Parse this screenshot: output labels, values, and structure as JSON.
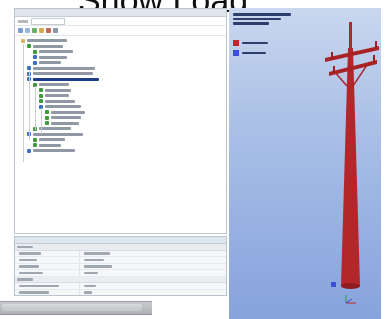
{
  "page": {
    "headline": "Show Load"
  },
  "outline": {
    "title": "",
    "filter_label": "",
    "filter_value": "",
    "tree": [
      {
        "label": ""
      },
      {
        "label": ""
      },
      {
        "label": ""
      },
      {
        "label": ""
      },
      {
        "label": ""
      },
      {
        "label": ""
      },
      {
        "label": ""
      },
      {
        "label": ""
      },
      {
        "label": ""
      },
      {
        "label": ""
      },
      {
        "label": ""
      },
      {
        "label": ""
      },
      {
        "label": ""
      },
      {
        "label": ""
      },
      {
        "label": ""
      },
      {
        "label": ""
      },
      {
        "label": ""
      },
      {
        "label": ""
      },
      {
        "label": ""
      },
      {
        "label": ""
      },
      {
        "label": ""
      },
      {
        "label": ""
      },
      {
        "label": ""
      }
    ]
  },
  "details": {
    "groups": [
      {
        "title": "",
        "rows": [
          {
            "key": "",
            "value": ""
          },
          {
            "key": "",
            "value": ""
          },
          {
            "key": "",
            "value": ""
          },
          {
            "key": "",
            "value": ""
          }
        ]
      },
      {
        "title": "",
        "rows": [
          {
            "key": "",
            "value": ""
          },
          {
            "key": "",
            "value": ""
          }
        ]
      }
    ]
  },
  "viewport": {
    "title_lines": [
      "",
      "",
      ""
    ],
    "legend": [
      {
        "label": "",
        "color": "#c0272d"
      },
      {
        "label": "",
        "color": "#3b4fd8"
      }
    ],
    "pole_color": "#b3262a",
    "background_top": "#c9d7ef",
    "background_bottom": "#86a3dd"
  },
  "colors": {
    "selection": "#1d3f8a",
    "panel_border": "#b9c4d0",
    "tree_icon_green": "#3f9a3a",
    "tree_icon_blue": "#3a6fc2",
    "tree_icon_folder": "#d8b458"
  }
}
